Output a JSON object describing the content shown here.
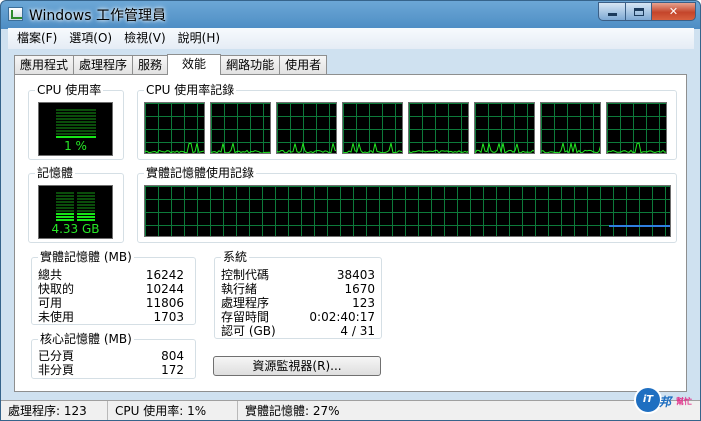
{
  "window": {
    "title": "Windows 工作管理員"
  },
  "menu": [
    "檔案(F)",
    "選項(O)",
    "檢視(V)",
    "說明(H)"
  ],
  "tabs": [
    {
      "label": "應用程式",
      "active": false
    },
    {
      "label": "處理程序",
      "active": false
    },
    {
      "label": "服務",
      "active": false
    },
    {
      "label": "效能",
      "active": true
    },
    {
      "label": "網路功能",
      "active": false
    },
    {
      "label": "使用者",
      "active": false
    }
  ],
  "cpu_usage": {
    "title": "CPU 使用率",
    "value": "1 %",
    "level": 0.01
  },
  "cpu_history": {
    "title": "CPU 使用率記錄",
    "cores": 8
  },
  "memory": {
    "title": "記憶體",
    "value": "4.33 GB",
    "level": 0.27
  },
  "memory_history": {
    "title": "實體記憶體使用記錄",
    "level": 0.27
  },
  "physical_memory": {
    "title": "實體記憶體 (MB)",
    "rows": [
      {
        "label": "總共",
        "value": "16242"
      },
      {
        "label": "快取的",
        "value": "10244"
      },
      {
        "label": "可用",
        "value": "11806"
      },
      {
        "label": "未使用",
        "value": "1703"
      }
    ]
  },
  "kernel_memory": {
    "title": "核心記憶體 (MB)",
    "rows": [
      {
        "label": "已分頁",
        "value": "804"
      },
      {
        "label": "非分頁",
        "value": "172"
      }
    ]
  },
  "system": {
    "title": "系統",
    "rows": [
      {
        "label": "控制代碼",
        "value": "38403"
      },
      {
        "label": "執行緒",
        "value": "1670"
      },
      {
        "label": "處理程序",
        "value": "123"
      },
      {
        "label": "存留時間",
        "value": "0:02:40:17"
      },
      {
        "label": "認可 (GB)",
        "value": "4 / 31"
      }
    ]
  },
  "resource_monitor_button": "資源監視器(R)...",
  "statusbar": {
    "processes": "處理程序: 123",
    "cpu": "CPU 使用率: 1%",
    "memory": "實體記憶體: 27%"
  },
  "watermark": {
    "mark": "iT",
    "text": "邦",
    "sub": "幫忙"
  }
}
